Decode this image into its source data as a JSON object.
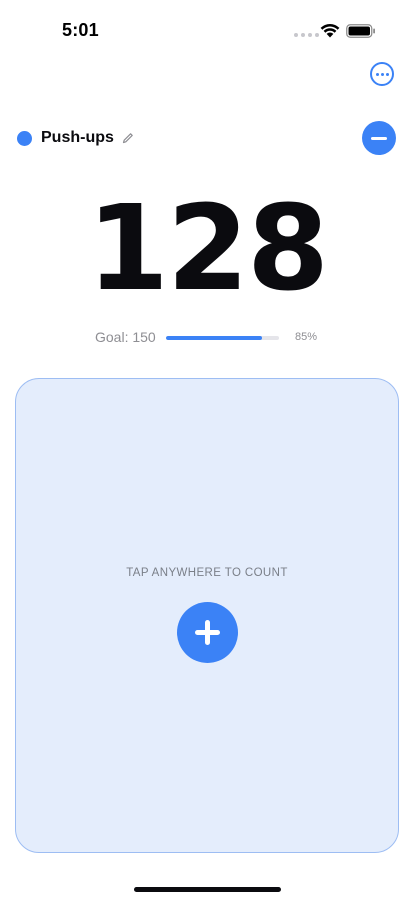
{
  "status_bar": {
    "time": "5:01",
    "icons": [
      "signal-dots-icon",
      "wifi-icon",
      "battery-icon"
    ]
  },
  "toolbar": {
    "more_icon": "ellipsis-circle-icon"
  },
  "counter": {
    "name": "Push-ups",
    "color": "#3b82f6",
    "edit_icon": "pencil-icon",
    "decrement_icon": "minus-icon",
    "value": "128"
  },
  "goal": {
    "label": "Goal: 150",
    "progress": 0.85,
    "percent_label": "85%"
  },
  "tap_area": {
    "hint": "TAP ANYWHERE TO COUNT",
    "increment_icon": "plus-icon"
  },
  "colors": {
    "accent": "#3b82f6",
    "tap_area_bg": "#e4edfc",
    "tap_area_border": "#9dbdf3"
  }
}
